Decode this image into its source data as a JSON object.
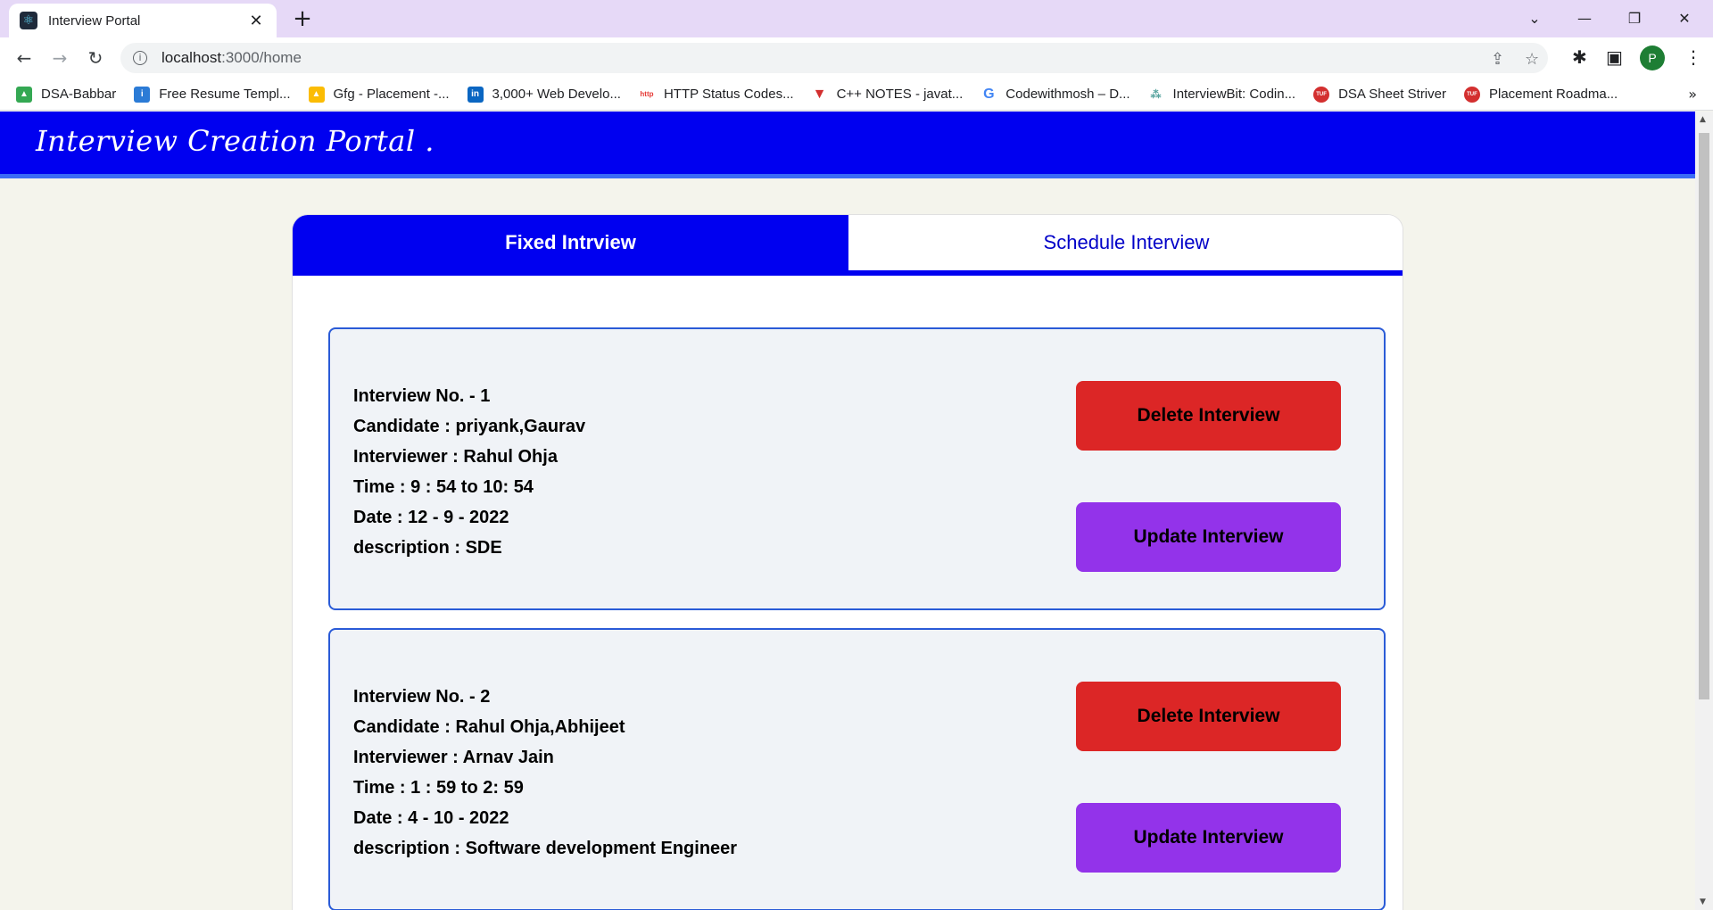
{
  "browser": {
    "tab_title": "Interview Portal",
    "url_host": "localhost",
    "url_path": ":3000/home",
    "profile_initial": "P",
    "bookmarks": [
      {
        "label": "DSA-Babbar",
        "icon": "google-drive-icon",
        "color": "#34a853"
      },
      {
        "label": "Free Resume Templ...",
        "icon": "resume-icon",
        "color": "#2b7bd6"
      },
      {
        "label": "Gfg - Placement -...",
        "icon": "google-drive-icon",
        "color": "#fbbc04"
      },
      {
        "label": "3,000+ Web Develo...",
        "icon": "linkedin-icon",
        "color": "#0a66c2"
      },
      {
        "label": "HTTP Status Codes...",
        "icon": "http-icon",
        "color": "#e53935"
      },
      {
        "label": "C++ NOTES - javat...",
        "icon": "javatpoint-icon",
        "color": "#d32f2f"
      },
      {
        "label": "Codewithmosh – D...",
        "icon": "google-icon",
        "color": "#4285f4"
      },
      {
        "label": "InterviewBit: Codin...",
        "icon": "interviewbit-icon",
        "color": "#5aa5a0"
      },
      {
        "label": "DSA Sheet Striver",
        "icon": "tuf-icon",
        "color": "#d32f2f"
      },
      {
        "label": "Placement Roadma...",
        "icon": "tuf-icon",
        "color": "#d32f2f"
      }
    ]
  },
  "app": {
    "brand": "Interview Creation Portal .",
    "tabs": {
      "fixed": "Fixed Intrview",
      "schedule": "Schedule Interview"
    },
    "interviews": [
      {
        "number": "Interview No. - 1",
        "candidate": "Candidate : priyank,Gaurav",
        "interviewer": "Interviewer : Rahul Ohja",
        "time": "Time : 9 : 54 to 10: 54",
        "date": "Date : 12 - 9 - 2022",
        "description": "description : SDE",
        "delete_label": "Delete Interview",
        "update_label": "Update Interview"
      },
      {
        "number": "Interview No. - 2",
        "candidate": "Candidate : Rahul Ohja,Abhijeet",
        "interviewer": "Interviewer : Arnav Jain",
        "time": "Time : 1 : 59 to 2: 59",
        "date": "Date : 4 - 10 - 2022",
        "description": "description : Software development Engineer",
        "delete_label": "Delete Interview",
        "update_label": "Update Interview"
      }
    ]
  },
  "colors": {
    "header": "#0000f0",
    "delete": "#dc2626",
    "update": "#9333ea",
    "card_border": "#2a5bd7"
  }
}
